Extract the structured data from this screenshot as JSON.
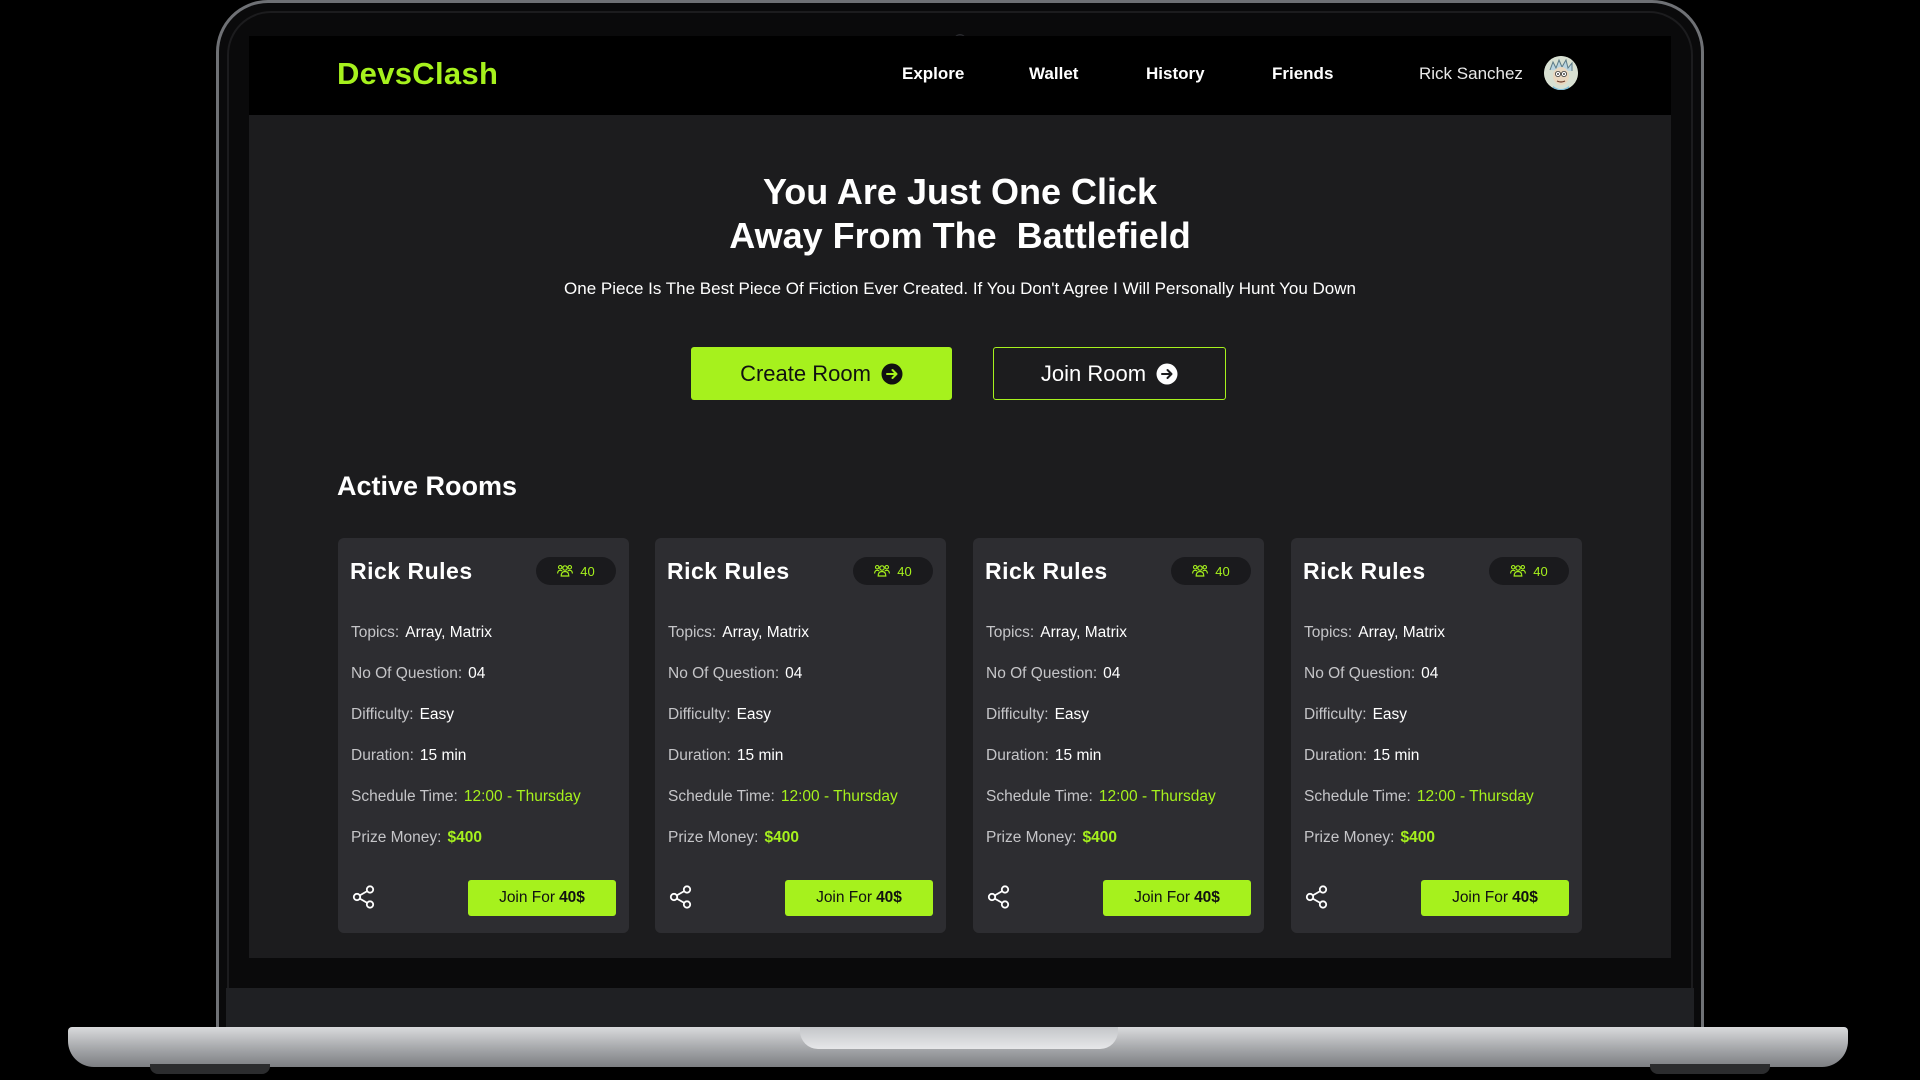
{
  "app": {
    "logo": "DevsClash"
  },
  "nav": {
    "links": [
      "Explore",
      "Wallet",
      "History",
      "Friends"
    ],
    "user_name": "Rick Sanchez"
  },
  "hero": {
    "title_line1": "You Are Just One Click",
    "title_line2": "Away From The  Battlefield",
    "subtitle": "One Piece Is The Best Piece Of Fiction Ever Created. If You Don't Agree I Will Personally Hunt You Down",
    "create_button": "Create Room",
    "join_button": "Join Room"
  },
  "active_rooms": {
    "title": "Active Rooms",
    "labels": {
      "topics": "Topics:",
      "questions": "No Of Question:",
      "difficulty": "Difficulty:",
      "duration": "Duration:",
      "schedule": "Schedule Time:",
      "prize": "Prize Money:"
    },
    "rooms": [
      {
        "name": "Rick Rules",
        "players": "40",
        "topics": "Array, Matrix",
        "questions": "04",
        "difficulty": "Easy",
        "duration": "15 min",
        "schedule": "12:00 - Thursday",
        "prize": "$400",
        "join_prefix": "Join For",
        "join_amount": "40$"
      },
      {
        "name": "Rick Rules",
        "players": "40",
        "topics": "Array, Matrix",
        "questions": "04",
        "difficulty": "Easy",
        "duration": "15 min",
        "schedule": "12:00 - Thursday",
        "prize": "$400",
        "join_prefix": "Join For",
        "join_amount": "40$"
      },
      {
        "name": "Rick Rules",
        "players": "40",
        "topics": "Array, Matrix",
        "questions": "04",
        "difficulty": "Easy",
        "duration": "15 min",
        "schedule": "12:00 - Thursday",
        "prize": "$400",
        "join_prefix": "Join For",
        "join_amount": "40$"
      },
      {
        "name": "Rick Rules",
        "players": "40",
        "topics": "Array, Matrix",
        "questions": "04",
        "difficulty": "Easy",
        "duration": "15 min",
        "schedule": "12:00 - Thursday",
        "prize": "$400",
        "join_prefix": "Join For",
        "join_amount": "40$"
      }
    ]
  },
  "icons": {
    "players": "people-group-icon",
    "share": "share-icon",
    "arrow": "arrow-right-circle-icon",
    "avatar": "avatar"
  },
  "colors": {
    "accent": "#a6f11d",
    "background": "#1c1c1e",
    "nav": "#000000",
    "card": "#2d2d31"
  }
}
